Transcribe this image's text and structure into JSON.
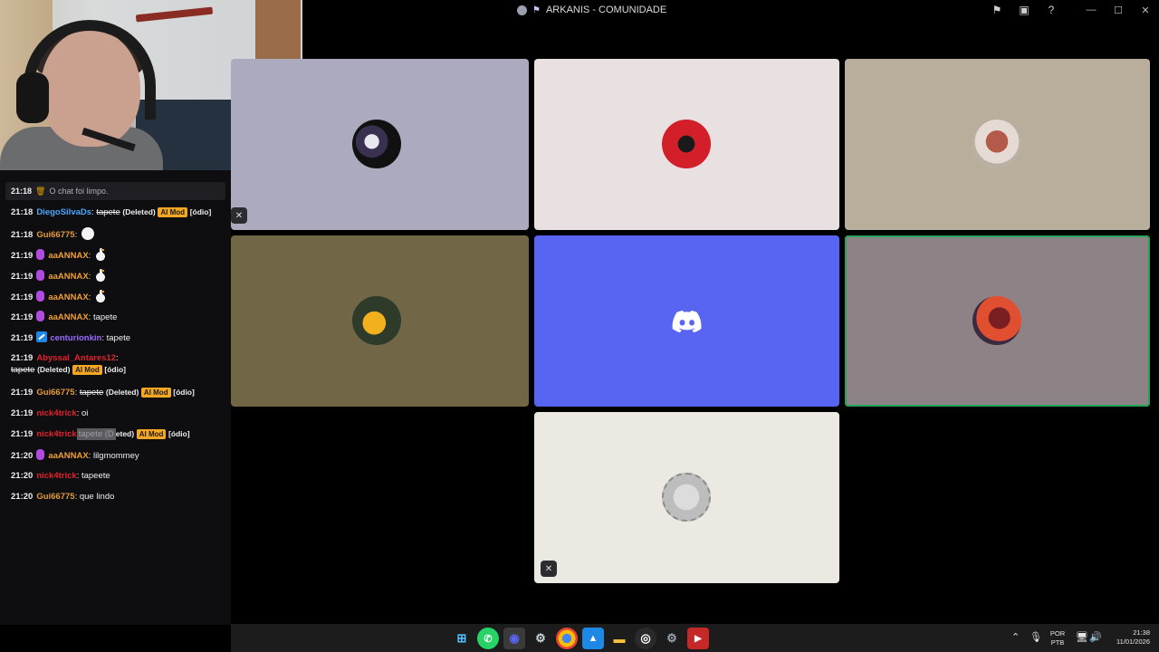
{
  "window": {
    "title": "ARKANIS - COMUNIDADE",
    "icons": [
      "flag-icon",
      "inbox-icon",
      "help-icon"
    ],
    "controls": [
      "—",
      "☐",
      "✕"
    ]
  },
  "chat": {
    "system_message": {
      "time": "21:18",
      "text": "O chat foi limpo."
    },
    "deleted_label": "(Deleted)",
    "ai_mod_label": "AI Mod",
    "tag_label": "[ódio]",
    "messages": [
      {
        "time": "21:18",
        "user": "DiegoSilvaDs",
        "text": "tapete",
        "color": "#4aa8ff"
      },
      {
        "time": "21:18",
        "user": "Gui66775",
        "text": "",
        "color": "#e39b3d"
      },
      {
        "time": "21:19",
        "user": "aaANNAX",
        "text": "",
        "color": "#f0a030"
      },
      {
        "time": "21:19",
        "user": "aaANNAX",
        "text": "",
        "color": "#f0a030"
      },
      {
        "time": "21:19",
        "user": "aaANNAX",
        "text": "",
        "color": "#f0a030"
      },
      {
        "time": "21:19",
        "user": "aaANNAX",
        "text": "tapete",
        "color": "#f0a030"
      },
      {
        "time": "21:19",
        "user": "centurionkin",
        "text": "tapete",
        "color": "#9b6bff"
      },
      {
        "time": "21:19",
        "user": "Abyssal_Antares12",
        "text": "tapete",
        "color": "#e0222f"
      },
      {
        "time": "21:19",
        "user": "Gui66775",
        "text": "tapete",
        "color": "#e39b3d"
      },
      {
        "time": "21:19",
        "user": "nick4trick",
        "text": "oi",
        "color": "#e0222f"
      },
      {
        "time": "21:19",
        "user": "nick4trick",
        "text": "tapete",
        "overlay": "tapete (D",
        "color": "#e0222f"
      },
      {
        "time": "21:20",
        "user": "aaANNAX",
        "text": "lilgmommey",
        "color": "#f0a030"
      },
      {
        "time": "21:20",
        "user": "nick4trick",
        "text": "tapeete",
        "color": "#e0222f"
      },
      {
        "time": "21:20",
        "user": "Gui66775",
        "text": "que lindo",
        "color": "#e39b3d"
      }
    ]
  },
  "stage": {
    "tiles": [
      {
        "name": "tile-user-1",
        "bg": "#abaabf",
        "avatar": "av1",
        "muted": true
      },
      {
        "name": "tile-user-2",
        "bg": "#e9e0e1",
        "avatar": "av2",
        "muted": false
      },
      {
        "name": "tile-user-3",
        "bg": "#b8ae9b",
        "avatar": "av3",
        "muted": false
      },
      {
        "name": "tile-user-4",
        "bg": "#716646",
        "avatar": "av4",
        "muted": false
      },
      {
        "name": "tile-user-5",
        "bg": "#5865f2",
        "avatar": "discord-logo",
        "muted": false
      },
      {
        "name": "tile-user-6",
        "bg": "#8d8387",
        "avatar": "av5",
        "muted": false,
        "speaking": true
      },
      {
        "name": "tile-user-7",
        "bg": "#ece8e2",
        "avatar": "av6",
        "muted": true
      }
    ],
    "accent_colors": {
      "discord": "#5865f2",
      "speaking": "#23a55a"
    }
  },
  "taskbar": {
    "apps": [
      "windows-start-icon",
      "whatsapp-icon",
      "discord-icon",
      "steam-icon",
      "chrome-icon",
      "photos-icon",
      "file-explorer-icon",
      "obs-icon",
      "settings-icon",
      "youtube-icon"
    ],
    "language_top": "POR",
    "language_bottom": "PTB",
    "time": "21:38",
    "date": "11/01/2026"
  }
}
